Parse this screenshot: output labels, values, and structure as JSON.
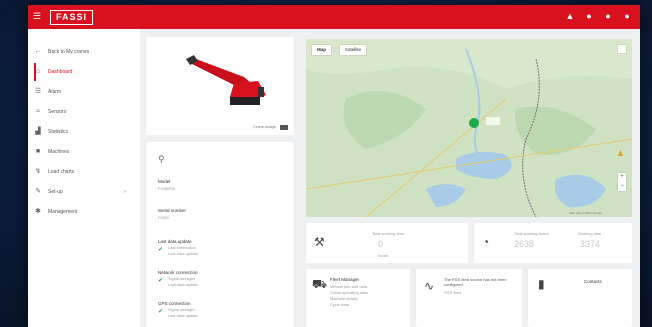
{
  "brand": {
    "logo": "FASSI",
    "color": "#d9101e"
  },
  "topbar": {
    "menu_icon": "hamburger-icon",
    "icons": [
      "warning-icon",
      "bell-icon",
      "help-icon",
      "user-icon"
    ]
  },
  "sidebar": {
    "items": [
      {
        "label": "Back to My cranes",
        "icon": "arrow-left-icon"
      },
      {
        "label": "Dashboard",
        "icon": "home-icon",
        "active": true
      },
      {
        "label": "Alarm",
        "icon": "list-icon"
      },
      {
        "label": "Sensors",
        "icon": "sensor-icon"
      },
      {
        "label": "Statistics",
        "icon": "bar-chart-icon"
      },
      {
        "label": "Machines",
        "icon": "machine-icon"
      },
      {
        "label": "Load charts",
        "icon": "chart-icon"
      },
      {
        "label": "Set-up",
        "icon": "wrench-icon",
        "expandable": true
      },
      {
        "label": "Management",
        "icon": "cog-icon"
      }
    ]
  },
  "crane_card": {
    "caption": "Crane image"
  },
  "info_card": {
    "search_icon": "search-icon",
    "fields": [
      {
        "label": "Model",
        "value": "F1050RA"
      },
      {
        "label": "Serial number",
        "value": "F0000"
      }
    ],
    "statuses": [
      {
        "label": "Last data update",
        "line1": "Last connection",
        "line2": "Last data update"
      },
      {
        "label": "Network connection",
        "line1": "Signal strength",
        "line2": "Last data update"
      },
      {
        "label": "GPS connection",
        "line1": "Signal strength",
        "line2": "Last data update"
      }
    ]
  },
  "map": {
    "tab_map": "Map",
    "tab_satellite": "Satellite",
    "attribution": "Map data ©2023 Google"
  },
  "widgets": {
    "w1": {
      "icon": "crane-icon",
      "title": "Total working time",
      "value": "0",
      "unit": "hours"
    },
    "w2": {
      "icon": "gauge-icon",
      "title_a": "Total working hours",
      "value_a": "2638",
      "title_b": "Working time",
      "value_b": "3374"
    },
    "w3": {
      "icon": "truck-icon",
      "title": "Fleet Manager",
      "lines": [
        "Vehicle info and data",
        "Crane operating data",
        "Machine details",
        "Cycle data"
      ]
    },
    "w4": {
      "icon": "rss-icon",
      "title": "The RSS feed source has not been configured",
      "line": "RSS feed"
    },
    "w5": {
      "icon": "phone-icon",
      "title": "Contacts"
    }
  }
}
